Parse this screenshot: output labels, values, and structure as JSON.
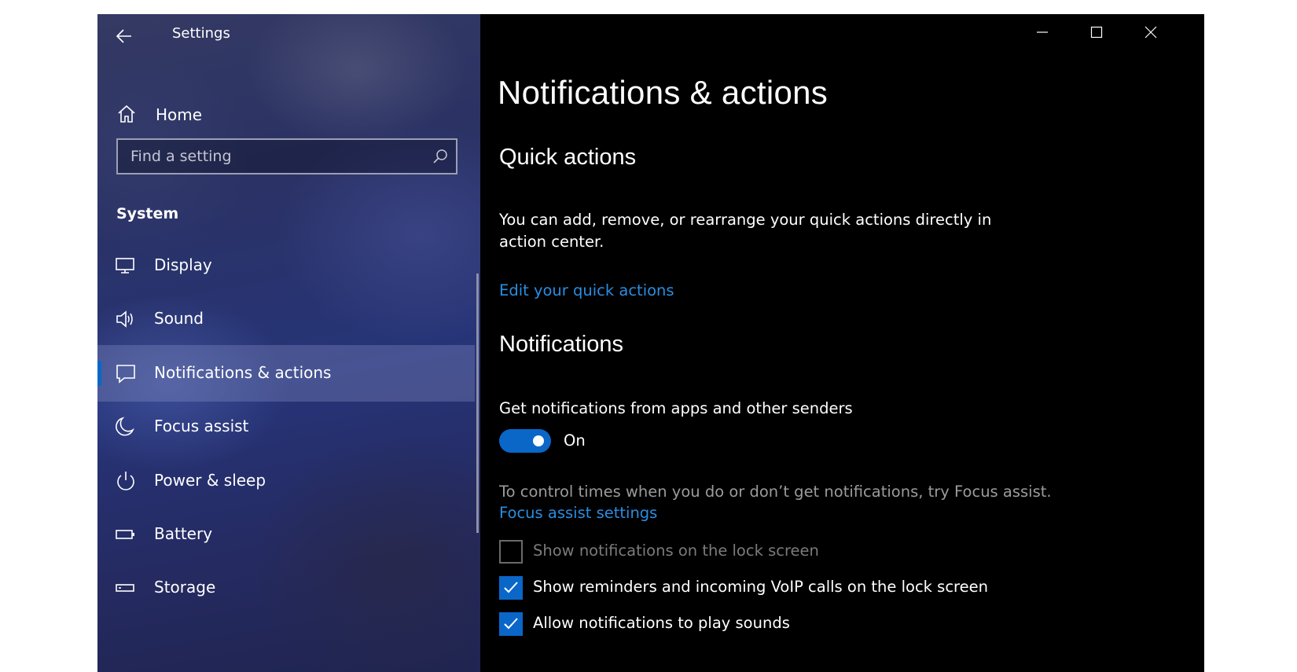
{
  "window": {
    "app_title": "Settings",
    "controls": [
      "minimize",
      "maximize",
      "close"
    ]
  },
  "sidebar": {
    "home_label": "Home",
    "search": {
      "placeholder": "Find a setting",
      "value": ""
    },
    "section_title": "System",
    "items": [
      {
        "label": "Display",
        "icon": "monitor-icon",
        "selected": false
      },
      {
        "label": "Sound",
        "icon": "speaker-icon",
        "selected": false
      },
      {
        "label": "Notifications & actions",
        "icon": "message-icon",
        "selected": true
      },
      {
        "label": "Focus assist",
        "icon": "moon-icon",
        "selected": false
      },
      {
        "label": "Power & sleep",
        "icon": "power-icon",
        "selected": false
      },
      {
        "label": "Battery",
        "icon": "battery-icon",
        "selected": false
      },
      {
        "label": "Storage",
        "icon": "storage-icon",
        "selected": false
      }
    ]
  },
  "main": {
    "page_title": "Notifications & actions",
    "quick_actions": {
      "heading": "Quick actions",
      "description": "You can add, remove, or rearrange your quick actions directly in action center.",
      "link": "Edit your quick actions"
    },
    "notifications": {
      "heading": "Notifications",
      "toggle_label": "Get notifications from apps and other senders",
      "toggle_state": "On",
      "focus_text": "To control times when you do or don’t get notifications, try Focus assist.",
      "focus_link": "Focus assist settings",
      "checkboxes": [
        {
          "label": "Show notifications on the lock screen",
          "checked": false,
          "enabled": false
        },
        {
          "label": "Show reminders and incoming VoIP calls on the lock screen",
          "checked": true,
          "enabled": true
        },
        {
          "label": "Allow notifications to play sounds",
          "checked": true,
          "enabled": true
        }
      ]
    }
  },
  "colors": {
    "accent": "#0a67c8",
    "link": "#2a8de1",
    "background": "#000000",
    "muted_text": "#9b9b9b"
  }
}
